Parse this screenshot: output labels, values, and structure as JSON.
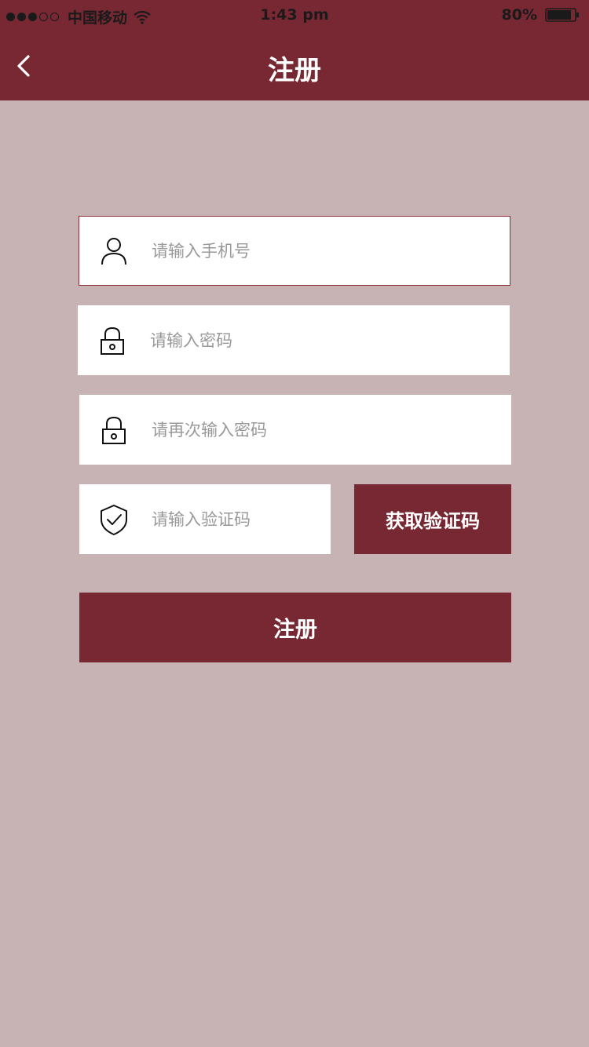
{
  "status_bar": {
    "carrier": "中国移动",
    "time": "1:43 pm",
    "battery": "80%"
  },
  "header": {
    "title": "注册"
  },
  "form": {
    "phone_placeholder": "请输入手机号",
    "password_placeholder": "请输入密码",
    "confirm_password_placeholder": "请再次输入密码",
    "code_placeholder": "请输入验证码",
    "get_code_label": "获取验证码",
    "submit_label": "注册"
  },
  "icons": {
    "back": "chevron-left-icon",
    "phone": "user-icon",
    "password": "lock-icon",
    "confirm_password": "lock-icon",
    "code": "shield-check-icon"
  },
  "colors": {
    "primary": "#772832",
    "background": "#c8b3b4",
    "field": "#ffffff",
    "placeholder": "#999999"
  }
}
